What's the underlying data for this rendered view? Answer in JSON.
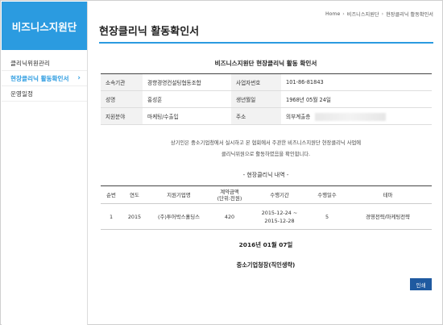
{
  "sidebar": {
    "brand": "비즈니스지원단",
    "items": [
      {
        "label": "클리닉위원관리",
        "active": false
      },
      {
        "label": "현장클리닉 활동확인서",
        "active": true,
        "chevron": "›"
      },
      {
        "label": "운영일정",
        "active": false
      }
    ]
  },
  "breadcrumb": [
    "Home",
    "비즈니스지원단",
    "현장클리닉 활동확인서"
  ],
  "page_title": "현장클리닉 활동확인서",
  "document": {
    "title": "비즈니스지원단 현장클리닉 활동 확인서",
    "info": [
      {
        "label1": "소속기관",
        "value1": "경향경영컨설팅협동조합",
        "label2": "사업자번호",
        "value2": "101-86-81843"
      },
      {
        "label1": "성명",
        "value1": "홍성훈",
        "label2": "생년월일",
        "value2": "1968년 05월 24일"
      },
      {
        "label1": "지원분야",
        "value1": "마케팅/수출입",
        "label2": "주소",
        "value2": "의부계출층"
      }
    ],
    "statement_line1": "상기인은 중소기업청에서 실시하고 본 협회에서 주관한 비즈니스지원단 현장클리닉 사업에",
    "statement_line2": "클리닉위원으로 활동하였음을 확인합니다.",
    "section_title": "- 현장클리닉 내역 -",
    "table_headers": [
      "순번",
      "연도",
      "지원기업명",
      "계약금액\n(단위:천원)",
      "수행기간",
      "수행일수",
      "테마"
    ],
    "rows": [
      {
        "no": "1",
        "year": "2015",
        "company": "(주)투어박스홀딩스",
        "amount": "420",
        "period_start": "2015-12-24 ~",
        "period_end": "2015-12-28",
        "days": "5",
        "theme": "경영전략/마케팅전략"
      }
    ],
    "date": "2016년 01월 07일",
    "signer": "중소기업청장(직인생략)"
  },
  "buttons": {
    "print": "인쇄"
  },
  "colors": {
    "brand": "#2b9be0",
    "print_button": "#1f5aa0"
  }
}
